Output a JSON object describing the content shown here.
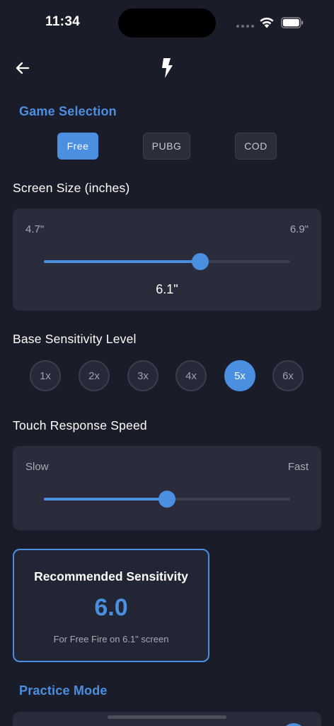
{
  "status": {
    "time": "11:34"
  },
  "header": {
    "back_icon": "arrow-left-icon",
    "logo_icon": "lightning-bolt-icon"
  },
  "game_selection": {
    "title": "Game Selection",
    "options": [
      {
        "label": "Free",
        "selected": true
      },
      {
        "label": "PUBG",
        "selected": false
      },
      {
        "label": "COD",
        "selected": false
      }
    ]
  },
  "screen_size": {
    "title": "Screen Size (inches)",
    "min_label": "4.7\"",
    "max_label": "6.9\"",
    "value_label": "6.1\"",
    "value": 6.1,
    "min": 4.7,
    "max": 6.9
  },
  "base_sensitivity": {
    "title": "Base Sensitivity Level",
    "options": [
      {
        "label": "1x",
        "selected": false
      },
      {
        "label": "2x",
        "selected": false
      },
      {
        "label": "3x",
        "selected": false
      },
      {
        "label": "4x",
        "selected": false
      },
      {
        "label": "5x",
        "selected": true
      },
      {
        "label": "6x",
        "selected": false
      }
    ]
  },
  "touch_speed": {
    "title": "Touch Response Speed",
    "min_label": "Slow",
    "max_label": "Fast",
    "level": 0.5
  },
  "recommended": {
    "title": "Recommended Sensitivity",
    "value": "6.0",
    "subtitle": "For Free Fire on 6.1\" screen"
  },
  "practice": {
    "title": "Practice Mode"
  },
  "colors": {
    "accent": "#4a8fe0",
    "background": "#1b1c29",
    "card": "#2a2c3b"
  }
}
